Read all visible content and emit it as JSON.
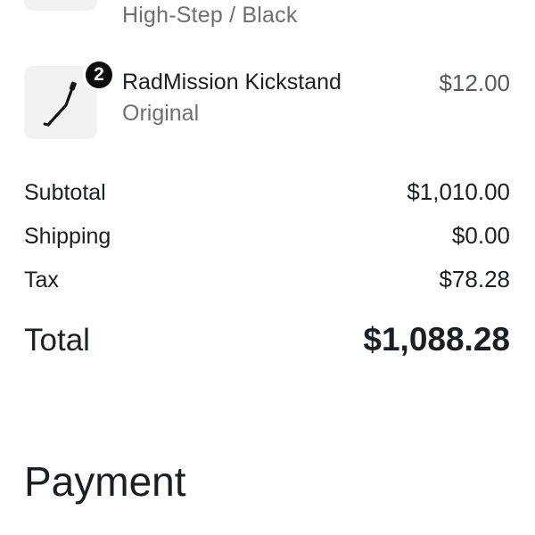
{
  "previous_item": {
    "variant": "High-Step / Black"
  },
  "item": {
    "quantity": "2",
    "name": "RadMission Kickstand",
    "variant": "Original",
    "price": "$12.00",
    "image_icon": "kickstand-icon"
  },
  "summary": {
    "subtotal_label": "Subtotal",
    "subtotal_value": "$1,010.00",
    "shipping_label": "Shipping",
    "shipping_value": "$0.00",
    "tax_label": "Tax",
    "tax_value": "$78.28",
    "total_label": "Total",
    "total_value": "$1,088.28"
  },
  "payment": {
    "heading": "Payment"
  }
}
